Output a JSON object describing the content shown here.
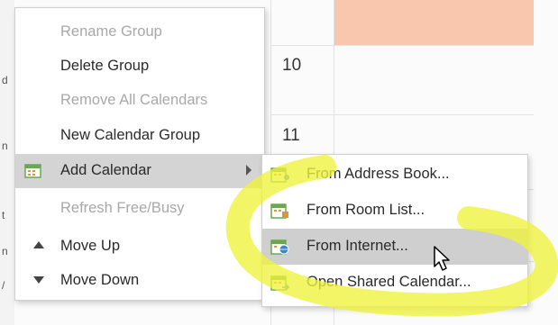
{
  "calendar": {
    "hours": [
      "10",
      "11"
    ],
    "left_strip": [
      "d",
      "n",
      "t",
      "n",
      "/"
    ]
  },
  "menu": {
    "items": [
      {
        "label": "Rename Group",
        "enabled": false
      },
      {
        "label": "Delete Group",
        "enabled": true
      },
      {
        "label": "Remove All Calendars",
        "enabled": false
      },
      {
        "label": "New Calendar Group",
        "enabled": true
      },
      {
        "label": "Add Calendar",
        "enabled": true,
        "has_submenu": true,
        "icon": "add-calendar-icon"
      },
      {
        "label": "Refresh Free/Busy",
        "enabled": false
      },
      {
        "label": "Move Up",
        "enabled": true,
        "icon": "arrow-up-icon"
      },
      {
        "label": "Move Down",
        "enabled": true,
        "icon": "arrow-down-icon"
      }
    ]
  },
  "submenu": {
    "items": [
      {
        "label": "From Address Book...",
        "icon": "address-book-icon"
      },
      {
        "label": "From Room List...",
        "icon": "room-list-icon"
      },
      {
        "label": "From Internet...",
        "icon": "internet-calendar-icon",
        "highlighted": true
      },
      {
        "label": "Open Shared Calendar...",
        "icon": "shared-calendar-icon"
      }
    ]
  },
  "colors": {
    "highlight_marker": "#eef23a",
    "peach_header": "#f9c7ad",
    "menu_hover": "#d4d4d4",
    "icon_green": "#6aa84f",
    "icon_orange": "#e69138"
  }
}
